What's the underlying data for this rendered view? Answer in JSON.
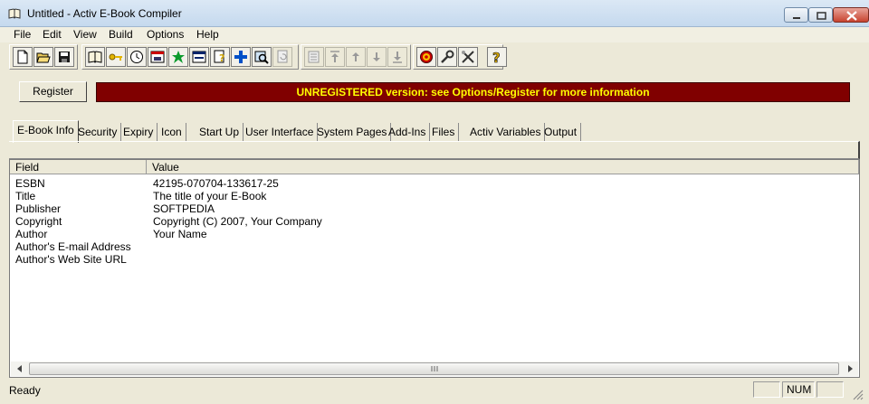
{
  "window": {
    "title": "Untitled - Activ E-Book Compiler"
  },
  "menu": [
    "File",
    "Edit",
    "View",
    "Build",
    "Options",
    "Help"
  ],
  "toolbar": {
    "buttons": [
      "new-file-icon",
      "open-folder-icon",
      "save-disk-icon",
      "book-icon",
      "key-icon",
      "clock-icon",
      "calendar-icon",
      "green-star-icon",
      "window-icon",
      "help-page-icon",
      "plus-icon",
      "search-image-icon",
      "refresh-page-icon",
      "properties-icon",
      "move-top-icon",
      "move-up-icon",
      "move-down-icon",
      "move-bottom-icon",
      "target-icon",
      "wrench-icon",
      "tools-icon",
      "question-icon"
    ]
  },
  "register": {
    "label": "Register"
  },
  "banner": {
    "text": "UNREGISTERED version: see Options/Register for more information",
    "bg": "#800000",
    "fg": "#ffff00"
  },
  "tabs": [
    "E-Book Info",
    "Security",
    "Expiry",
    "Icon",
    "Start Up",
    "User Interface",
    "System Pages",
    "Add-Ins",
    "Files",
    "Activ Variables",
    "Output"
  ],
  "grid": {
    "headers": [
      "Field",
      "Value"
    ],
    "rows": [
      {
        "field": "ESBN",
        "value": "42195-070704-133617-25"
      },
      {
        "field": "Title",
        "value": "The title of your E-Book"
      },
      {
        "field": "Publisher",
        "value": "SOFTPEDIA"
      },
      {
        "field": "Copyright",
        "value": "Copyright (C) 2007, Your Company"
      },
      {
        "field": "Author",
        "value": "Your Name"
      },
      {
        "field": "Author's E-mail Address",
        "value": ""
      },
      {
        "field": "Author's Web Site URL",
        "value": ""
      }
    ]
  },
  "status": {
    "text": "Ready",
    "indicator": "NUM"
  }
}
